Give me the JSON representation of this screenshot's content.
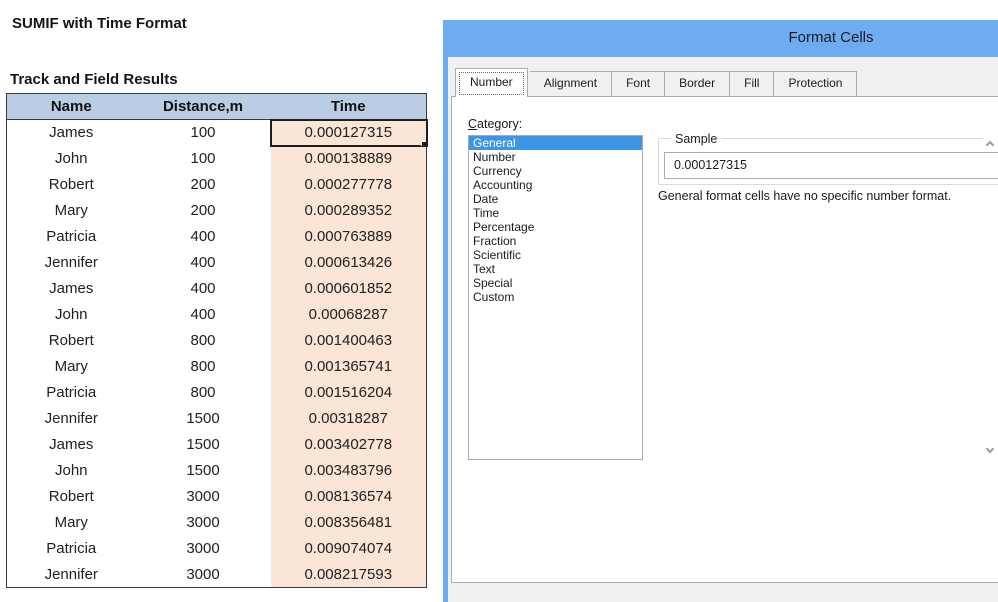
{
  "colors": {
    "titlebar_blue": "#6EACF1",
    "header_fill": "#B9CDE5",
    "time_fill": "#FBE5D6",
    "list_selection": "#3C95E5",
    "table_border": "#3A3A3A"
  },
  "sheet": {
    "title": "SUMIF with Time Format",
    "table_title": "Track and Field Results",
    "columns": [
      "Name",
      "Distance,m",
      "Time"
    ],
    "rows": [
      [
        "James",
        "100",
        "0.000127315"
      ],
      [
        "John",
        "100",
        "0.000138889"
      ],
      [
        "Robert",
        "200",
        "0.000277778"
      ],
      [
        "Mary",
        "200",
        "0.000289352"
      ],
      [
        "Patricia",
        "400",
        "0.000763889"
      ],
      [
        "Jennifer",
        "400",
        "0.000613426"
      ],
      [
        "James",
        "400",
        "0.000601852"
      ],
      [
        "John",
        "400",
        "0.00068287"
      ],
      [
        "Robert",
        "800",
        "0.001400463"
      ],
      [
        "Mary",
        "800",
        "0.001365741"
      ],
      [
        "Patricia",
        "800",
        "0.001516204"
      ],
      [
        "Jennifer",
        "1500",
        "0.00318287"
      ],
      [
        "James",
        "1500",
        "0.003402778"
      ],
      [
        "John",
        "1500",
        "0.003483796"
      ],
      [
        "Robert",
        "3000",
        "0.008136574"
      ],
      [
        "Mary",
        "3000",
        "0.008356481"
      ],
      [
        "Patricia",
        "3000",
        "0.009074074"
      ],
      [
        "Jennifer",
        "3000",
        "0.008217593"
      ]
    ],
    "selected_cell": {
      "row": 0,
      "col": 2
    }
  },
  "dialog": {
    "title": "Format Cells",
    "tabs": [
      {
        "label": "Number",
        "active": true
      },
      {
        "label": "Alignment",
        "active": false
      },
      {
        "label": "Font",
        "active": false
      },
      {
        "label": "Border",
        "active": false
      },
      {
        "label": "Fill",
        "active": false
      },
      {
        "label": "Protection",
        "active": false
      }
    ],
    "category_label": {
      "accesskey": "C",
      "rest": "ategory:"
    },
    "categories": [
      "General",
      "Number",
      "Currency",
      "Accounting",
      "Date",
      "Time",
      "Percentage",
      "Fraction",
      "Scientific",
      "Text",
      "Special",
      "Custom"
    ],
    "selected_category_index": 0,
    "sample": {
      "group_label": "Sample",
      "value": "0.000127315"
    },
    "description": "General format cells have no specific number format.",
    "scrollbar": {
      "up_icon": "chevron-up-icon",
      "down_icon": "chevron-down-icon"
    }
  }
}
